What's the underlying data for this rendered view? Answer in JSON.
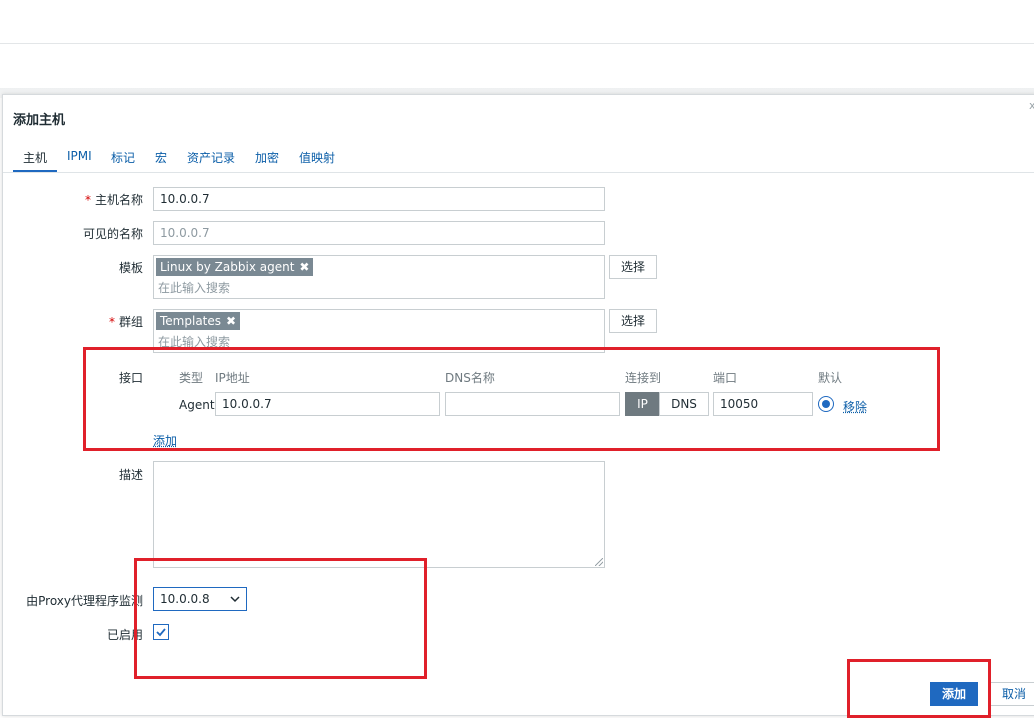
{
  "dialog": {
    "title": "添加主机",
    "close_symbol": "x"
  },
  "tabs": [
    "主机",
    "IPMI",
    "标记",
    "宏",
    "资产记录",
    "加密",
    "值映射"
  ],
  "form": {
    "host_name": {
      "label": "主机名称",
      "value": "10.0.0.7",
      "required": true
    },
    "visible_name": {
      "label": "可见的名称",
      "placeholder": "10.0.0.7"
    },
    "templates": {
      "label": "模板",
      "chip": "Linux by Zabbix agent",
      "chip_remove": "✖",
      "placeholder": "在此输入搜索",
      "select_button": "选择"
    },
    "groups": {
      "label": "群组",
      "chip": "Templates",
      "chip_remove": "✖",
      "placeholder": "在此输入搜索",
      "select_button": "选择",
      "required": true
    },
    "interfaces": {
      "label": "接口",
      "headers": {
        "type": "类型",
        "ip": "IP地址",
        "dns": "DNS名称",
        "connect_to": "连接到",
        "port": "端口",
        "default": "默认"
      },
      "row": {
        "type": "Agent",
        "ip": "10.0.0.7",
        "dns": "",
        "connect_ip": "IP",
        "connect_dns": "DNS",
        "port": "10050",
        "remove": "移除"
      },
      "add_link": "添加"
    },
    "description": {
      "label": "描述",
      "value": ""
    },
    "proxy": {
      "label": "由Proxy代理程序监测",
      "value": "10.0.0.8"
    },
    "enabled": {
      "label": "已启用",
      "checked": true
    }
  },
  "footer": {
    "add_button": "添加",
    "cancel_button": "取消"
  },
  "colors": {
    "accent": "#1f69c0",
    "link": "#0b5ea8",
    "chip": "#7a8993",
    "highlight": "#e0202a"
  }
}
